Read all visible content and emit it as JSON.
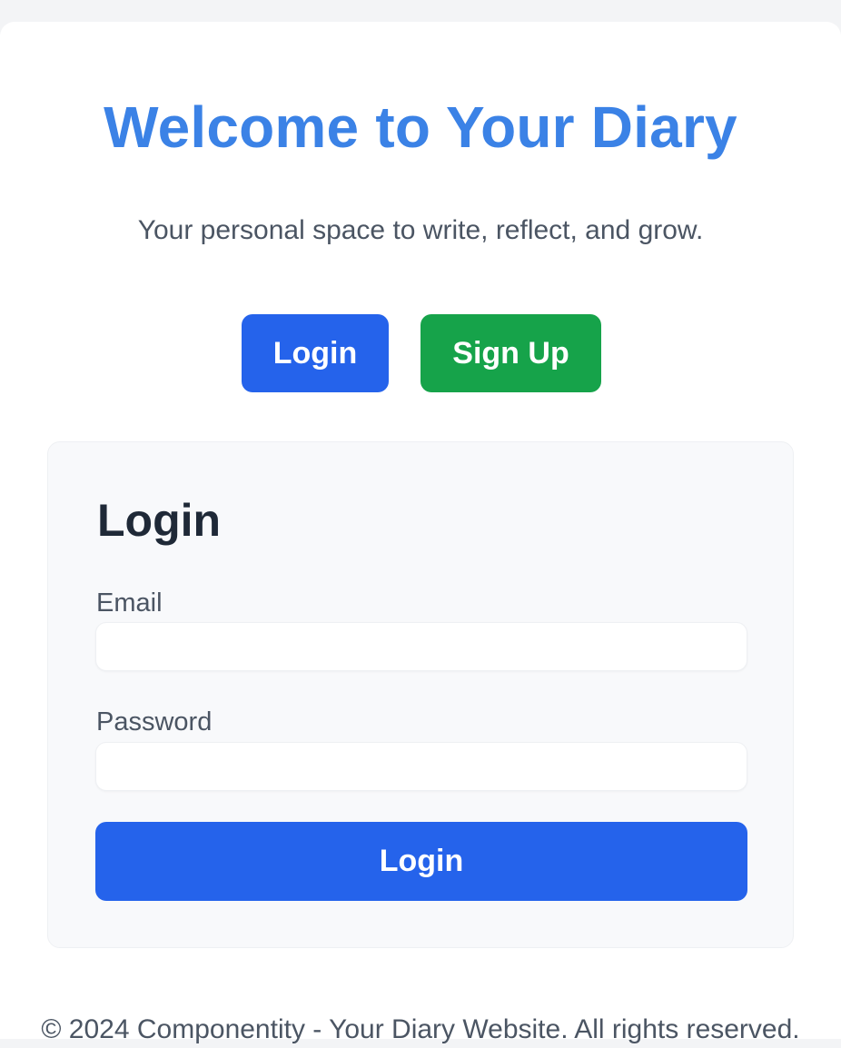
{
  "header": {
    "title": "Welcome to Your Diary",
    "subtitle": "Your personal space to write, reflect, and grow."
  },
  "actions": {
    "login_label": "Login",
    "signup_label": "Sign Up"
  },
  "login_form": {
    "title": "Login",
    "email_label": "Email",
    "email_value": "",
    "password_label": "Password",
    "password_value": "",
    "submit_label": "Login"
  },
  "footer": {
    "text": "© 2024 Componentity - Your Diary Website. All rights reserved."
  },
  "colors": {
    "title": "#3b82e6",
    "primary": "#2563eb",
    "success": "#16a34a"
  }
}
